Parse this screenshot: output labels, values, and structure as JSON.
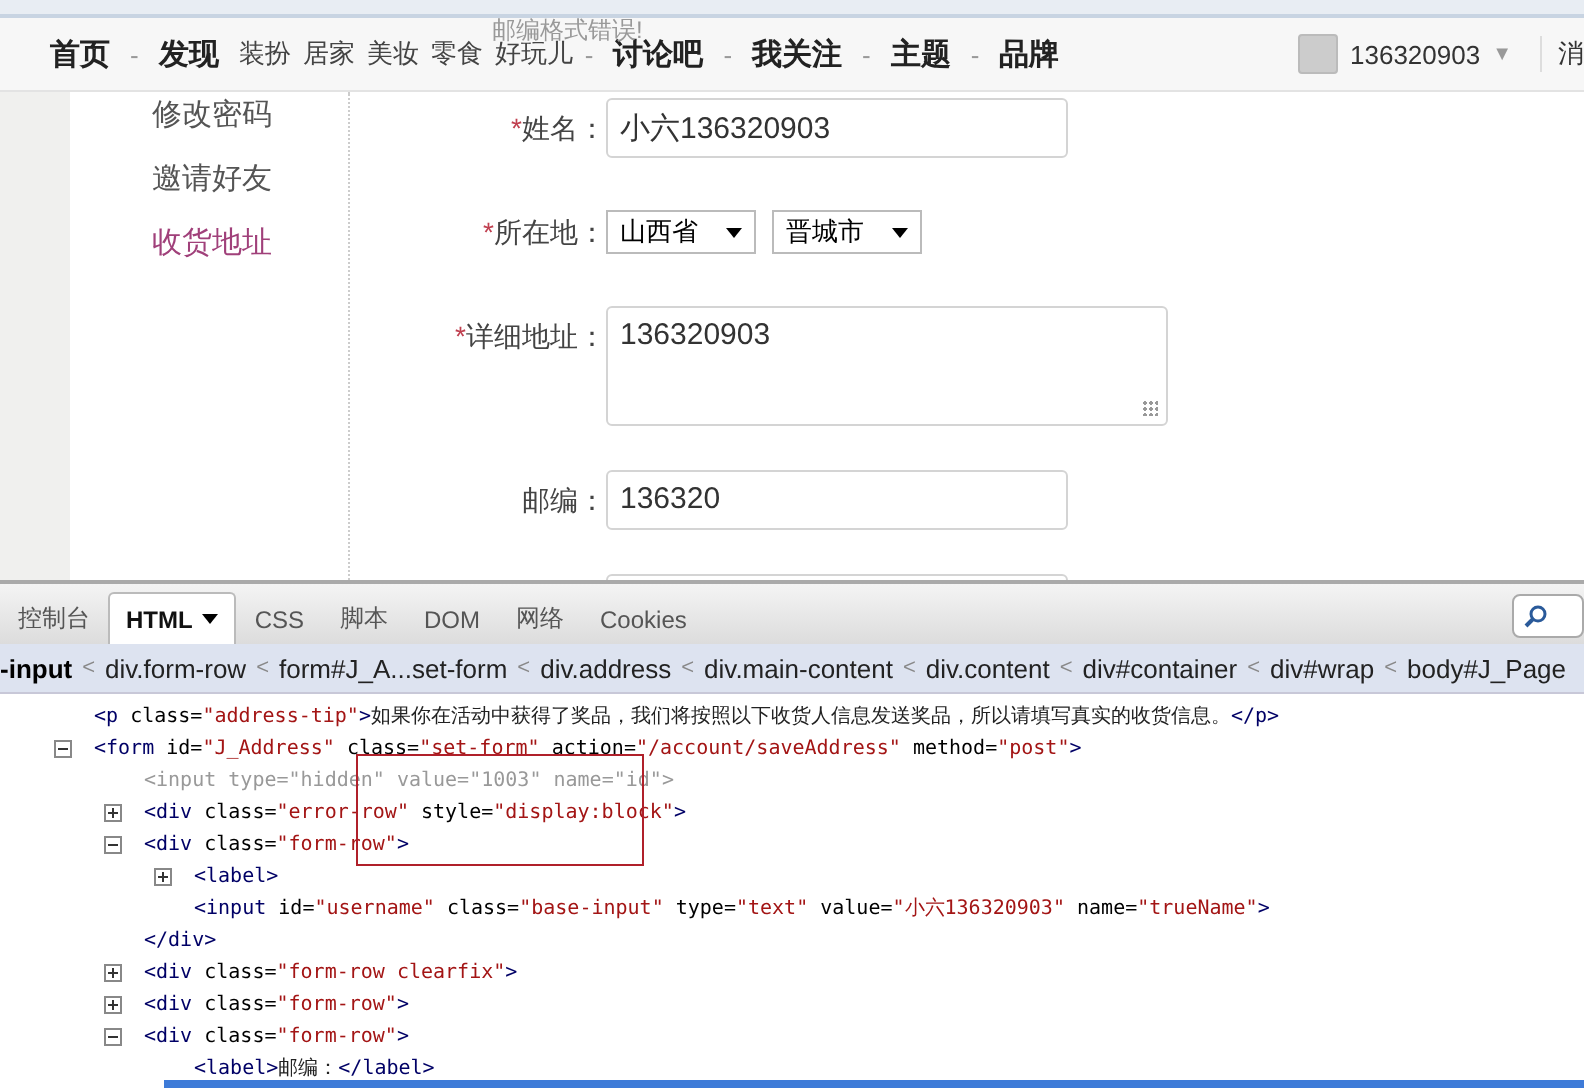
{
  "error_tip": "邮编格式错误!",
  "nav": {
    "items": [
      {
        "label": "首页",
        "kind": "main"
      },
      {
        "label": "-",
        "kind": "separator"
      },
      {
        "label": "发现",
        "kind": "main"
      },
      {
        "label": "装扮",
        "kind": "sub"
      },
      {
        "label": "居家",
        "kind": "sub"
      },
      {
        "label": "美妆",
        "kind": "sub"
      },
      {
        "label": "零食",
        "kind": "sub"
      },
      {
        "label": "好玩儿",
        "kind": "sub"
      },
      {
        "label": "-",
        "kind": "separator"
      },
      {
        "label": "讨论吧",
        "kind": "main"
      },
      {
        "label": "-",
        "kind": "separator"
      },
      {
        "label": "我关注",
        "kind": "main"
      },
      {
        "label": "-",
        "kind": "separator"
      },
      {
        "label": "主题",
        "kind": "main"
      },
      {
        "label": "-",
        "kind": "separator"
      },
      {
        "label": "品牌",
        "kind": "main"
      }
    ],
    "user": {
      "name": "136320903",
      "caret": "▼"
    },
    "edge_link": "消"
  },
  "sidebar": {
    "items": [
      {
        "label": "修改密码",
        "selected": false
      },
      {
        "label": "邀请好友",
        "selected": false
      },
      {
        "label": "收货地址",
        "selected": true
      }
    ]
  },
  "form": {
    "rows": [
      {
        "kind": "text",
        "required": true,
        "label": "姓名：",
        "value": "小六136320903"
      },
      {
        "kind": "selects",
        "required": true,
        "label": "所在地：",
        "options": [
          "山西省",
          "晋城市"
        ]
      },
      {
        "kind": "textarea",
        "required": true,
        "label": "详细地址：",
        "value": "136320903"
      },
      {
        "kind": "text",
        "required": false,
        "label": "邮编：",
        "value": "136320"
      },
      {
        "kind": "cut",
        "required": false
      }
    ],
    "required_mark": "*"
  },
  "devtools": {
    "tabs": [
      {
        "label": "控制台",
        "selected": false,
        "menu": false
      },
      {
        "label": "HTML",
        "selected": true,
        "menu": true
      },
      {
        "label": "CSS",
        "selected": false,
        "menu": false
      },
      {
        "label": "脚本",
        "selected": false,
        "menu": false
      },
      {
        "label": "DOM",
        "selected": false,
        "menu": false
      },
      {
        "label": "网络",
        "selected": false,
        "menu": false
      },
      {
        "label": "Cookies",
        "selected": false,
        "menu": false
      }
    ],
    "breadcrumb": {
      "current": "-input",
      "separator": "<",
      "items": [
        "div.form-row",
        "form#J_A...set-form",
        "div.address",
        "div.main-content",
        "div.content",
        "div#container",
        "div#wrap",
        "body#J_Page"
      ]
    },
    "tree": [
      {
        "kind": "leaf",
        "dim": false,
        "parts": [
          {
            "kind": "tag",
            "text": "<p "
          },
          {
            "kind": "attr",
            "text": "class="
          },
          {
            "kind": "value",
            "text": "\"address-tip\""
          },
          {
            "kind": "tag",
            "text": ">"
          },
          {
            "kind": "text",
            "text": "如果你在活动中获得了奖品，我们将按照以下收货人信息发送奖品，所以请填写真实的收货信息。"
          },
          {
            "kind": "tag",
            "text": "</p>"
          }
        ]
      },
      {
        "kind": "branch",
        "expanded": true,
        "dim": false,
        "parts": [
          {
            "kind": "tag",
            "text": "<form "
          },
          {
            "kind": "attr",
            "text": "id="
          },
          {
            "kind": "value",
            "text": "\"J_Address\""
          },
          {
            "kind": "attr",
            "text": " class="
          },
          {
            "kind": "value",
            "text": "\"set-form\""
          },
          {
            "kind": "attr",
            "text": " action="
          },
          {
            "kind": "value",
            "text": "\"/account/saveAddress\""
          },
          {
            "kind": "attr",
            "text": " method="
          },
          {
            "kind": "value",
            "text": "\"post\""
          },
          {
            "kind": "tag",
            "text": ">"
          }
        ],
        "children": [
          {
            "kind": "leaf",
            "dim": true,
            "parts": [
              {
                "kind": "tag",
                "text": "<input "
              },
              {
                "kind": "attr",
                "text": "type="
              },
              {
                "kind": "value",
                "text": "\"hidden\""
              },
              {
                "kind": "attr",
                "text": " value="
              },
              {
                "kind": "value",
                "text": "\"1003\""
              },
              {
                "kind": "attr",
                "text": " name="
              },
              {
                "kind": "value",
                "text": "\"id\""
              },
              {
                "kind": "tag",
                "text": ">"
              }
            ]
          },
          {
            "kind": "branch",
            "expanded": false,
            "dim": false,
            "parts": [
              {
                "kind": "tag",
                "text": "<div "
              },
              {
                "kind": "attr",
                "text": "class="
              },
              {
                "kind": "value",
                "text": "\"error-row\""
              },
              {
                "kind": "attr",
                "text": " style="
              },
              {
                "kind": "value",
                "text": "\"display:block\""
              },
              {
                "kind": "tag",
                "text": ">"
              }
            ]
          },
          {
            "kind": "branch",
            "expanded": true,
            "dim": false,
            "parts": [
              {
                "kind": "tag",
                "text": "<div "
              },
              {
                "kind": "attr",
                "text": "class="
              },
              {
                "kind": "value",
                "text": "\"form-row\""
              },
              {
                "kind": "tag",
                "text": ">"
              }
            ],
            "children": [
              {
                "kind": "branch",
                "expanded": false,
                "dim": false,
                "parts": [
                  {
                    "kind": "tag",
                    "text": "<label>"
                  }
                ]
              },
              {
                "kind": "leaf",
                "dim": false,
                "parts": [
                  {
                    "kind": "tag",
                    "text": "<input "
                  },
                  {
                    "kind": "attr",
                    "text": "id="
                  },
                  {
                    "kind": "value",
                    "text": "\"username\""
                  },
                  {
                    "kind": "attr",
                    "text": " class="
                  },
                  {
                    "kind": "value",
                    "text": "\"base-input\""
                  },
                  {
                    "kind": "attr",
                    "text": " type="
                  },
                  {
                    "kind": "value",
                    "text": "\"text\""
                  },
                  {
                    "kind": "attr",
                    "text": " value="
                  },
                  {
                    "kind": "value",
                    "text": "\"小六136320903\""
                  },
                  {
                    "kind": "attr",
                    "text": " name="
                  },
                  {
                    "kind": "value",
                    "text": "\"trueName\""
                  },
                  {
                    "kind": "tag",
                    "text": ">"
                  }
                ]
              }
            ],
            "close": "</div>"
          },
          {
            "kind": "branch",
            "expanded": false,
            "dim": false,
            "parts": [
              {
                "kind": "tag",
                "text": "<div "
              },
              {
                "kind": "attr",
                "text": "class="
              },
              {
                "kind": "value",
                "text": "\"form-row clearfix\""
              },
              {
                "kind": "tag",
                "text": ">"
              }
            ]
          },
          {
            "kind": "branch",
            "expanded": false,
            "dim": false,
            "parts": [
              {
                "kind": "tag",
                "text": "<div "
              },
              {
                "kind": "attr",
                "text": "class="
              },
              {
                "kind": "value",
                "text": "\"form-row\""
              },
              {
                "kind": "tag",
                "text": ">"
              }
            ]
          },
          {
            "kind": "branch",
            "expanded": true,
            "dim": false,
            "parts": [
              {
                "kind": "tag",
                "text": "<div "
              },
              {
                "kind": "attr",
                "text": "class="
              },
              {
                "kind": "value",
                "text": "\"form-row\""
              },
              {
                "kind": "tag",
                "text": ">"
              }
            ],
            "children": [
              {
                "kind": "leaf",
                "dim": false,
                "parts": [
                  {
                    "kind": "tag",
                    "text": "<label>"
                  },
                  {
                    "kind": "text",
                    "text": "邮编："
                  },
                  {
                    "kind": "tag",
                    "text": "</label>"
                  }
                ]
              }
            ]
          }
        ]
      }
    ]
  }
}
